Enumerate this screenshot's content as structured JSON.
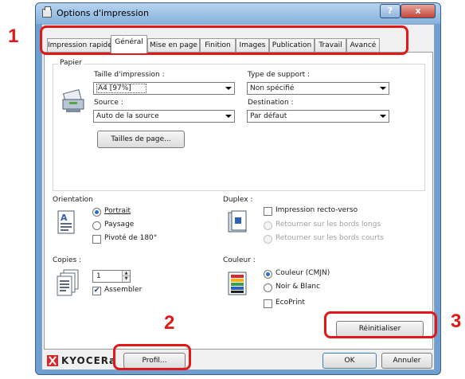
{
  "window": {
    "title": "Options d'impression",
    "help_label": "?",
    "close_label": "x"
  },
  "tabs": [
    {
      "label": "Impression rapide",
      "active": false
    },
    {
      "label": "Général",
      "active": true
    },
    {
      "label": "Mise en page",
      "active": false
    },
    {
      "label": "Finition",
      "active": false
    },
    {
      "label": "Images",
      "active": false
    },
    {
      "label": "Publication",
      "active": false
    },
    {
      "label": "Travail",
      "active": false
    },
    {
      "label": "Avancé",
      "active": false
    }
  ],
  "paper": {
    "group_label": "Papier",
    "print_size_label": "Taille d'impression :",
    "print_size_value": "A4  [97%]",
    "media_type_label": "Type de support :",
    "media_type_value": "Non spécifié",
    "source_label": "Source :",
    "source_value": "Auto de la source",
    "destination_label": "Destination :",
    "destination_value": "Par défaut",
    "page_sizes_button": "Tailles de page..."
  },
  "orientation": {
    "label": "Orientation",
    "portrait": "Portrait",
    "landscape": "Paysage",
    "rotated": "Pivoté de 180°",
    "selected": "portrait"
  },
  "duplex": {
    "label": "Duplex :",
    "two_sided": "Impression recto-verso",
    "flip_long": "Retourner sur les bords longs",
    "flip_short": "Retourner sur les bords courts"
  },
  "copies": {
    "label": "Copies :",
    "value": "1",
    "collate": "Assembler",
    "collate_checked": true
  },
  "color": {
    "label": "Couleur :",
    "color_option": "Couleur (CMJN)",
    "bw_option": "Noir & Blanc",
    "ecoprint": "EcoPrint",
    "selected": "color"
  },
  "buttons": {
    "reset": "Réinitialiser",
    "profile": "Profil...",
    "ok": "OK",
    "cancel": "Annuler"
  },
  "brand": "KYOCERa",
  "annotations": [
    "1",
    "2",
    "3"
  ],
  "colors": {
    "annotation_red": "#e11818",
    "title_blue": "#86b2dc",
    "close_red": "#c4473a"
  }
}
